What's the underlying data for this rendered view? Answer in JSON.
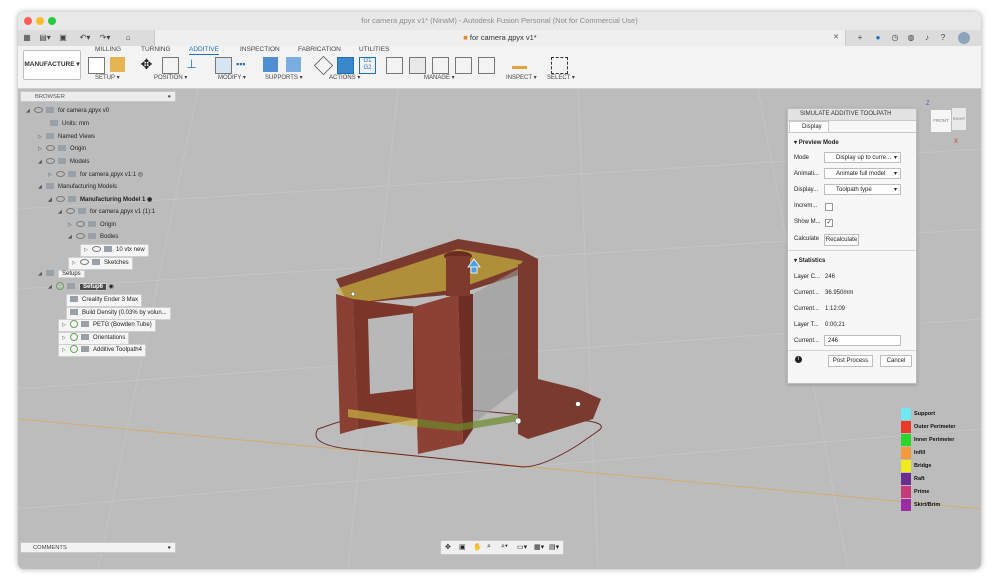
{
  "window": {
    "title": "for camera друх v1* (NinaM) - Autodesk Fusion Personal (Not for Commercial Use)",
    "doc_tab": "for camera друх v1*"
  },
  "ribbon": {
    "workspace": "MANUFACTURE",
    "tabs": [
      "MILLING",
      "TURNING",
      "ADDITIVE",
      "INSPECTION",
      "FABRICATION",
      "UTILITIES"
    ],
    "active_tab": "ADDITIVE",
    "groups": [
      "SETUP",
      "POSITION",
      "MODIFY",
      "SUPPORTS",
      "ACTIONS",
      "MANAGE",
      "INSPECT",
      "SELECT"
    ]
  },
  "browser": {
    "title": "BROWSER",
    "rows": [
      "for camera друх v0",
      "Units: mm",
      "Named Views",
      "Origin",
      "Models",
      "for camera друх v1:1",
      "Manufacturing Models",
      "Manufacturing Model 1",
      "for camera друх v1 (1):1",
      "Origin",
      "Bodies",
      "10 vtx new",
      "Sketches",
      "Setups",
      "Setup6",
      "Creality Ender 3 Max",
      "Build Density (0.03% by volun...",
      "PETG (Bowden Tube)",
      "Orientations",
      "Additive Toolpath4"
    ]
  },
  "simulate": {
    "title": "SIMULATE ADDITIVE TOOLPATH",
    "tab": "Display",
    "preview_section": "Preview Mode",
    "mode_label": "Mode",
    "mode_value": "Display up to curre...",
    "anim_label": "Animati...",
    "anim_value": "Animate full model",
    "display_label": "Display...",
    "display_value": "Toolpath type",
    "incr_label": "Increm...",
    "showm_label": "Show M...",
    "calculate_label": "Calculate",
    "recalculate": "Recalculate",
    "stats_section": "Statistics",
    "stat_labels": [
      "Layer C...",
      "Current...",
      "Current...",
      "Layer T...",
      "Current..."
    ],
    "stat_values": [
      "246",
      "36.950mm",
      "1:12:09",
      "0:00:21",
      "246"
    ],
    "post_process": "Post Process",
    "cancel": "Cancel"
  },
  "legend": [
    {
      "label": "Support",
      "color": "#6fe8f2"
    },
    {
      "label": "Outer Perimeter",
      "color": "#e8392b"
    },
    {
      "label": "Inner Perimeter",
      "color": "#2dd52f"
    },
    {
      "label": "Infill",
      "color": "#f39a3c"
    },
    {
      "label": "Bridge",
      "color": "#f1ea1c"
    },
    {
      "label": "Raft",
      "color": "#6b2e8e"
    },
    {
      "label": "Prime",
      "color": "#c43b78"
    },
    {
      "label": "Skirt/Brim",
      "color": "#9b2ea0"
    }
  ],
  "comments": "COMMENTS",
  "viewcube": {
    "front": "FRONT",
    "right": "RIGHT",
    "x": "X",
    "z": "Z"
  }
}
